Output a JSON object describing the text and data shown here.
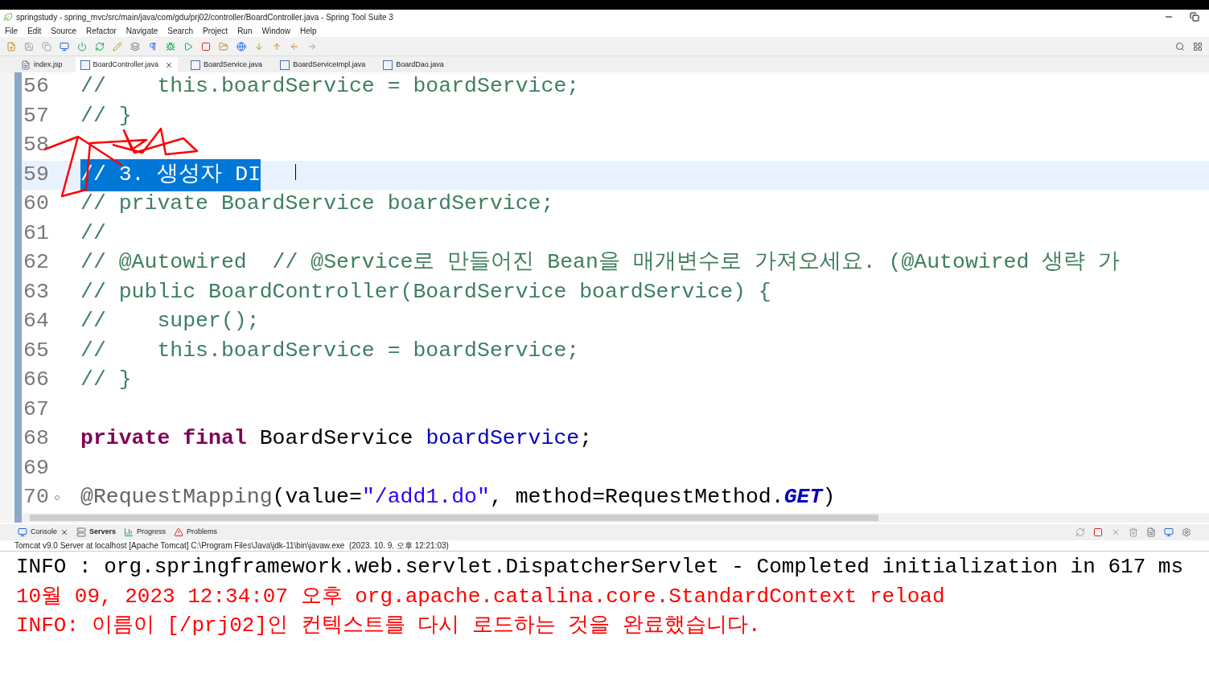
{
  "window": {
    "title": "springstudy - spring_mvc/src/main/java/com/gdu/prj02/controller/BoardController.java - Spring Tool Suite 3"
  },
  "menu": [
    "File",
    "Edit",
    "Source",
    "Refactor",
    "Navigate",
    "Search",
    "Project",
    "Run",
    "Window",
    "Help"
  ],
  "editor_tabs": [
    {
      "label": "index.jsp",
      "kind": "jsp",
      "selected": false,
      "closable": false
    },
    {
      "label": "BoardController.java",
      "kind": "java",
      "selected": true,
      "closable": true
    },
    {
      "label": "BoardService.java",
      "kind": "java",
      "selected": false,
      "closable": false
    },
    {
      "label": "BoardServiceImpl.java",
      "kind": "java",
      "selected": false,
      "closable": false
    },
    {
      "label": "BoardDao.java",
      "kind": "java",
      "selected": false,
      "closable": false
    }
  ],
  "code_lines": [
    {
      "number": "56",
      "selected": false,
      "tokens": [
        {
          "kind": "comment",
          "text": "//    this.boardService = boardService;"
        }
      ]
    },
    {
      "number": "57",
      "selected": false,
      "tokens": [
        {
          "kind": "comment",
          "text": "// }"
        }
      ]
    },
    {
      "number": "58",
      "selected": false
    },
    {
      "number": "59",
      "selected": true,
      "tokens": [
        {
          "kind": "comment",
          "text": "// 3. 생성자 DI"
        }
      ]
    },
    {
      "number": "60",
      "selected": false,
      "tokens": [
        {
          "kind": "comment",
          "text": "// private BoardService boardService;"
        }
      ]
    },
    {
      "number": "61",
      "selected": false,
      "tokens": [
        {
          "kind": "comment",
          "text": "//"
        }
      ]
    },
    {
      "number": "62",
      "selected": false,
      "tokens": [
        {
          "kind": "comment",
          "text": "// @Autowired  // @Service로 만들어진 Bean을 매개변수로 가져오세요. (@Autowired 생략 가"
        }
      ]
    },
    {
      "number": "63",
      "selected": false,
      "tokens": [
        {
          "kind": "comment",
          "text": "// public BoardController(BoardService boardService) {"
        }
      ]
    },
    {
      "number": "64",
      "selected": false,
      "tokens": [
        {
          "kind": "comment",
          "text": "//    super();"
        }
      ]
    },
    {
      "number": "65",
      "selected": false,
      "tokens": [
        {
          "kind": "comment",
          "text": "//    this.boardService = boardService;"
        }
      ]
    },
    {
      "number": "66",
      "selected": false,
      "tokens": [
        {
          "kind": "comment",
          "text": "// }"
        }
      ]
    },
    {
      "number": "67",
      "selected": false
    },
    {
      "number": "68",
      "selected": false,
      "tokens": [
        {
          "kind": "keyword",
          "text": "private final"
        },
        {
          "kind": "plain",
          "text": " BoardService "
        },
        {
          "kind": "field",
          "text": "boardService"
        },
        {
          "kind": "plain",
          "text": ";"
        }
      ]
    },
    {
      "number": "69",
      "selected": false
    },
    {
      "number": "70",
      "selected": false,
      "fold": true,
      "tokens": [
        {
          "kind": "annotation",
          "text": "@RequestMapping"
        },
        {
          "kind": "plain",
          "text": "(value="
        },
        {
          "kind": "string",
          "text": "\"/add1.do\""
        },
        {
          "kind": "plain",
          "text": ", method=RequestMethod."
        },
        {
          "kind": "static",
          "text": "GET"
        },
        {
          "kind": "plain",
          "text": ")"
        }
      ]
    }
  ],
  "console_tabs": [
    {
      "label": "Console",
      "kind": "console",
      "selected": false,
      "closable": true
    },
    {
      "label": "Servers",
      "kind": "servers",
      "selected": true,
      "closable": false
    },
    {
      "label": "Progress",
      "kind": "progress",
      "selected": false,
      "closable": false
    },
    {
      "label": "Problems",
      "kind": "problems",
      "selected": false,
      "closable": false
    }
  ],
  "console_description": "Tomcat v9.0 Server at localhost [Apache Tomcat] C:\\Program Files\\Java\\jdk-11\\bin\\javaw.exe  (2023. 10. 9. 오후 12:21:03)",
  "console_lines": [
    {
      "kind": "info",
      "text": "INFO : org.springframework.web.servlet.DispatcherServlet - Completed initialization in 617 ms"
    },
    {
      "kind": "error",
      "text": "10월 09, 2023 12:34:07 오후 org.apache.catalina.core.StandardContext reload"
    },
    {
      "kind": "error",
      "text": "INFO: 이름이 [/prj02]인 컨텍스트를 다시 로드하는 것을 완료했습니다."
    }
  ]
}
